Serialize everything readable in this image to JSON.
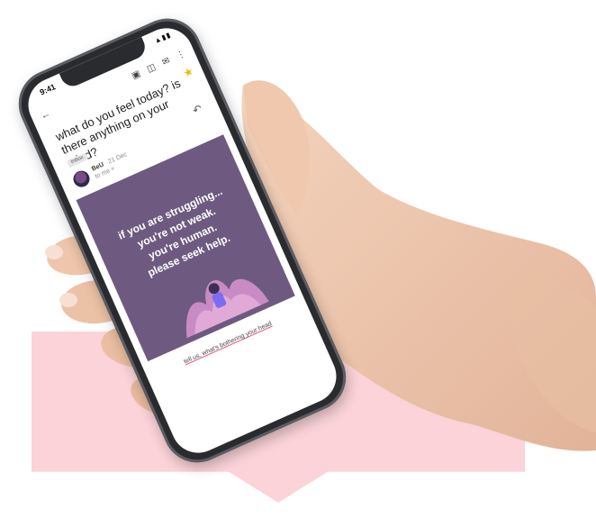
{
  "status_bar": {
    "time": "9:41",
    "icons": "▲▮▮"
  },
  "email": {
    "subject": "what do you feel today? is there anything on your mind?",
    "label": "Inbox",
    "sender": "BeU",
    "date": "21 Dec",
    "recipient": "to me",
    "banner_lines": [
      "if you are struggling...",
      "you're not weak.",
      "you're human.",
      "please seek help."
    ],
    "footer_link": "tell us, what's bothering your head"
  },
  "colors": {
    "banner_bg": "#6e5a80",
    "pink_banner": "#fbd3d8",
    "star": "#f3b400"
  },
  "icons": [
    "back-arrow-icon",
    "archive-icon",
    "trash-icon",
    "mail-icon",
    "more-icon",
    "star-icon",
    "reply-icon"
  ]
}
